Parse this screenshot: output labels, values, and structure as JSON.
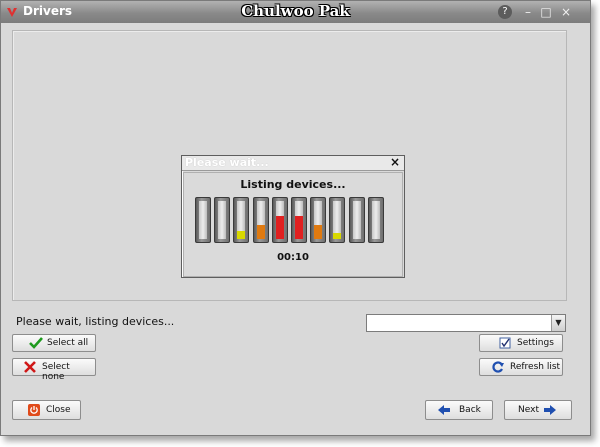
{
  "window": {
    "title": "Drivers",
    "app_title": "Chulwoo Pak",
    "controls": {
      "help": "?",
      "minimize": "–",
      "maximize": "□",
      "close": "×"
    }
  },
  "dialog": {
    "title": "Please wait...",
    "close": "×",
    "message": "Listing devices...",
    "timer": "00:10",
    "meters": [
      {
        "level": 0,
        "color": "none"
      },
      {
        "level": 0,
        "color": "none"
      },
      {
        "level": 0.2,
        "color": "#d8d800"
      },
      {
        "level": 0.38,
        "color": "#e07a10"
      },
      {
        "level": 0.6,
        "color": "#e02020"
      },
      {
        "level": 0.6,
        "color": "#e02020"
      },
      {
        "level": 0.38,
        "color": "#e07a10"
      },
      {
        "level": 0.15,
        "color": "#d8d800"
      },
      {
        "level": 0,
        "color": "none"
      },
      {
        "level": 0,
        "color": "none"
      }
    ]
  },
  "status": {
    "text": "Please wait, listing devices..."
  },
  "combo": {
    "value": ""
  },
  "buttons": {
    "select_all": "Select all",
    "select_none": "Select none",
    "settings": "Settings",
    "refresh_list": "Refresh list",
    "close": "Close",
    "back": "Back",
    "next": "Next"
  },
  "icons": {
    "select_all": "checkmark-icon",
    "select_none": "x-icon",
    "settings": "checkbox-icon",
    "refresh_list": "refresh-icon",
    "close": "power-icon",
    "back": "arrow-left-icon",
    "next": "arrow-right-icon"
  }
}
